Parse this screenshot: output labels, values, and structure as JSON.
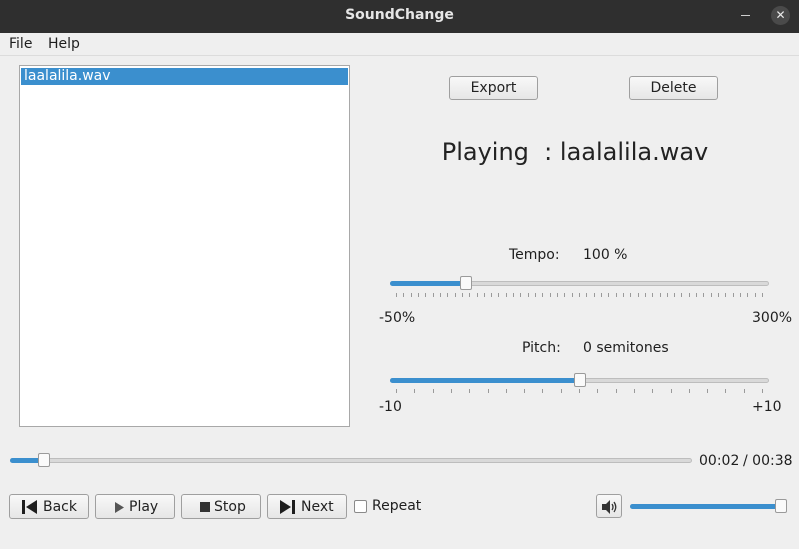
{
  "window": {
    "title": "SoundChange"
  },
  "menu": [
    "File",
    "Help"
  ],
  "files": [
    "laalalila.wav"
  ],
  "actions": {
    "export": "Export",
    "delete": "Delete"
  },
  "now_playing": {
    "prefix": "Playing  :",
    "file": "laalalila.wav"
  },
  "tempo": {
    "label": "Tempo:",
    "value": "100 %",
    "min_label": "-50%",
    "max_label": "300%",
    "level": 0.2
  },
  "pitch": {
    "label": "Pitch:",
    "value": "0 semitones",
    "min_label": "-10",
    "max_label": "+10",
    "level": 0.5
  },
  "playback": {
    "elapsed": "00:02",
    "total": "/ 00:38",
    "level": 0.05
  },
  "controls": {
    "back": "Back",
    "play": "Play",
    "stop": "Stop",
    "next": "Next",
    "repeat": "Repeat",
    "repeat_checked": false
  },
  "volume": {
    "level": 1.0
  },
  "colors": {
    "accent": "#3b8fce",
    "titlebar": "#2f2f2f"
  },
  "icons": [
    "skip-back-icon",
    "play-icon",
    "stop-icon",
    "skip-forward-icon",
    "speaker-icon",
    "minimize-icon",
    "close-icon"
  ]
}
